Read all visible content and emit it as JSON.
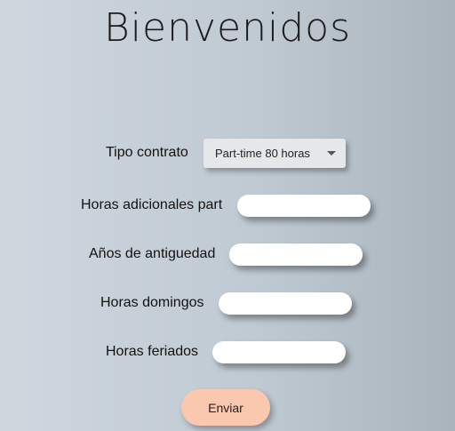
{
  "title": "Bienvenidos",
  "form": {
    "contract_type": {
      "label": "Tipo contrato",
      "selected": "Part-time 80 horas"
    },
    "extra_part_hours": {
      "label": "Horas adicionales part",
      "value": ""
    },
    "seniority_years": {
      "label": "Años de antiguedad",
      "value": ""
    },
    "sunday_hours": {
      "label": "Horas domingos",
      "value": ""
    },
    "holiday_hours": {
      "label": "Horas feriados",
      "value": ""
    },
    "submit_label": "Enviar"
  },
  "colors": {
    "submit_button": "#f9c8ae",
    "select_background": "#e6e7e9",
    "input_background": "#ffffff"
  }
}
